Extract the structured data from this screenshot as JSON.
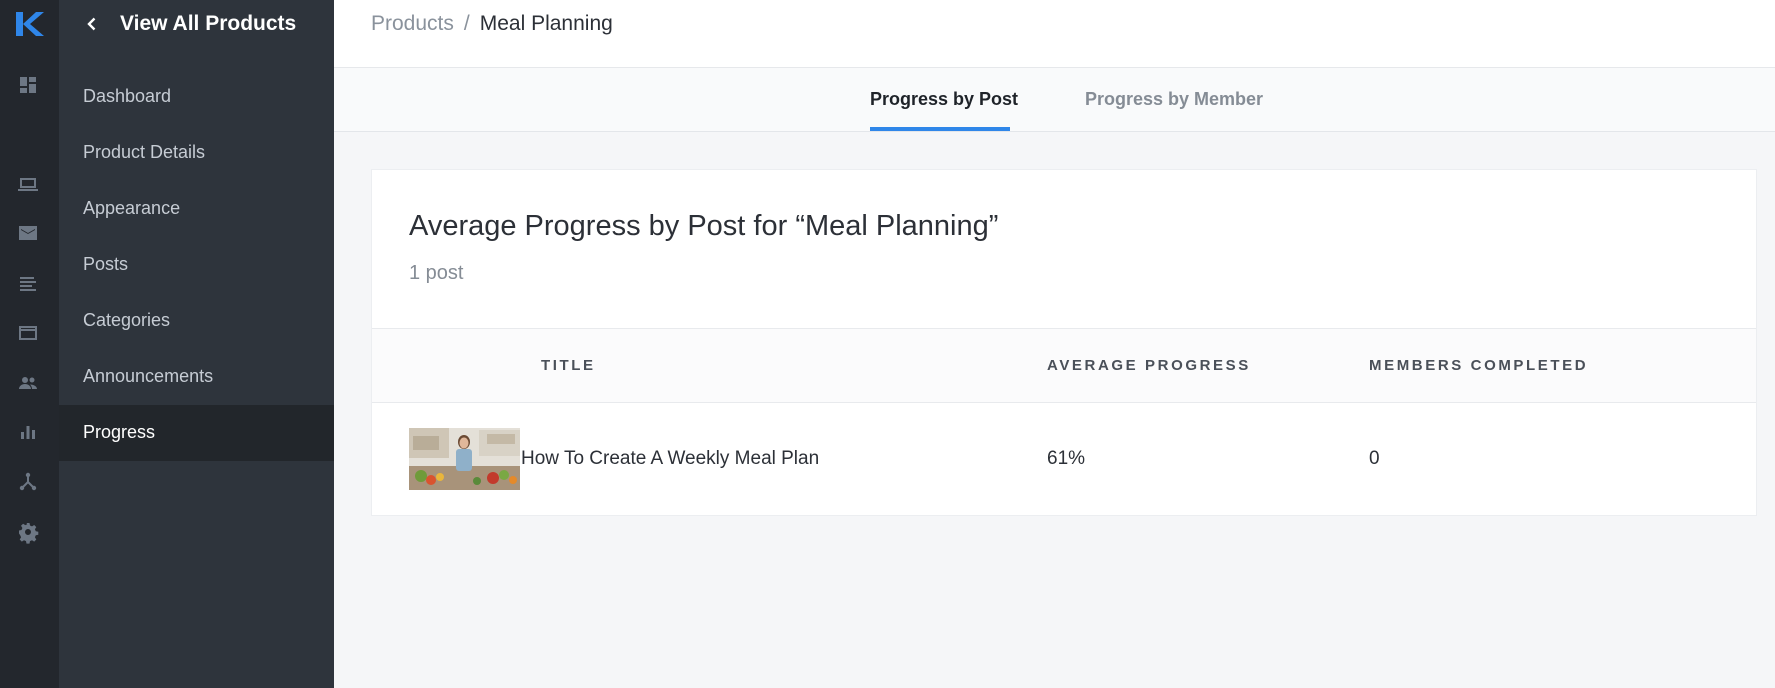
{
  "sidebar": {
    "back_label": "View All Products",
    "items": [
      {
        "label": "Dashboard",
        "active": false
      },
      {
        "label": "Product Details",
        "active": false
      },
      {
        "label": "Appearance",
        "active": false
      },
      {
        "label": "Posts",
        "active": false
      },
      {
        "label": "Categories",
        "active": false
      },
      {
        "label": "Announcements",
        "active": false
      },
      {
        "label": "Progress",
        "active": true
      }
    ]
  },
  "rail": {
    "logo": "kajabi-logo",
    "icons": [
      "dashboard-icon",
      "laptop-icon",
      "mail-icon",
      "list-icon",
      "browser-icon",
      "people-icon",
      "bar-chart-icon",
      "network-icon",
      "gear-icon"
    ]
  },
  "breadcrumb": {
    "parent": "Products",
    "separator": "/",
    "current": "Meal Planning"
  },
  "tabs": [
    {
      "label": "Progress by Post",
      "active": true
    },
    {
      "label": "Progress by Member",
      "active": false
    }
  ],
  "card": {
    "title": "Average Progress by Post for “Meal Planning”",
    "subtitle": "1 post",
    "columns": [
      "TITLE",
      "AVERAGE PROGRESS",
      "MEMBERS COMPLETED"
    ],
    "rows": [
      {
        "title": "How To Create A Weekly Meal Plan",
        "average_progress": "61%",
        "members_completed": "0"
      }
    ]
  },
  "colors": {
    "rail_bg": "#23272d",
    "subnav_bg": "#2e343c",
    "active_nav_bg": "#22262b",
    "accent": "#2f86e9",
    "logo": "#2f86e9"
  }
}
